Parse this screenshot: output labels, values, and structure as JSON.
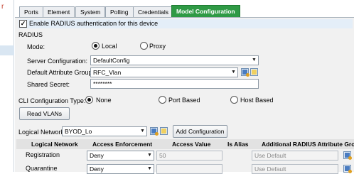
{
  "tabs": [
    {
      "label": "Ports",
      "active": false
    },
    {
      "label": "Element",
      "active": false
    },
    {
      "label": "System",
      "active": false
    },
    {
      "label": "Polling",
      "active": false
    },
    {
      "label": "Credentials",
      "active": false
    },
    {
      "label": "Model Configuration",
      "active": true
    }
  ],
  "enable_radius": {
    "label": "Enable RADIUS authentication for this device",
    "checked": true,
    "mark": "✓"
  },
  "radius": {
    "section_title": "RADIUS",
    "mode_label": "Mode:",
    "mode_options": [
      "Local",
      "Proxy"
    ],
    "mode_selected": "Local",
    "server_config_label": "Server Configuration:",
    "server_config_value": "DefaultConfig",
    "default_attr_group_label": "Default Attribute Group:",
    "default_attr_group_value": "RFC_Vlan",
    "shared_secret_label": "Shared Secret:",
    "shared_secret_value": "********"
  },
  "cli": {
    "label": "CLI Configuration Type:",
    "options": [
      "None",
      "Port Based",
      "Host Based"
    ],
    "selected": "None"
  },
  "read_vlans_label": "Read VLANs",
  "logical_network": {
    "label": "Logical Network:",
    "value": "BYOD_Lo",
    "add_config_label": "Add Configuration"
  },
  "table": {
    "headers": [
      "Logical Network",
      "Access Enforcement",
      "Access Value",
      "Is Alias",
      "Additional RADIUS Attribute Group"
    ],
    "rows": [
      {
        "network": "Registration",
        "enforcement": "Deny",
        "value": "50",
        "attr_group": "Use Default"
      },
      {
        "network": "Quarantine",
        "enforcement": "Deny",
        "value": "",
        "attr_group": "Use Default"
      }
    ]
  },
  "left_pane": {
    "glyph": "r"
  }
}
